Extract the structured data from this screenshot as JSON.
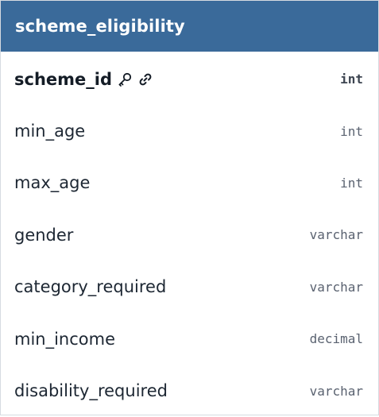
{
  "table": {
    "title": "scheme_eligibility",
    "columns": [
      {
        "name": "scheme_id",
        "type": "int",
        "primary_key": true,
        "icons": [
          "key-icon",
          "link-icon"
        ]
      },
      {
        "name": "min_age",
        "type": "int"
      },
      {
        "name": "max_age",
        "type": "int"
      },
      {
        "name": "gender",
        "type": "varchar"
      },
      {
        "name": "category_required",
        "type": "varchar"
      },
      {
        "name": "min_income",
        "type": "decimal"
      },
      {
        "name": "disability_required",
        "type": "varchar"
      }
    ]
  },
  "colors": {
    "header_bg": "#3a6a9a",
    "header_text": "#ffffff",
    "name_text": "#1d2733",
    "type_text": "#5a6270"
  }
}
